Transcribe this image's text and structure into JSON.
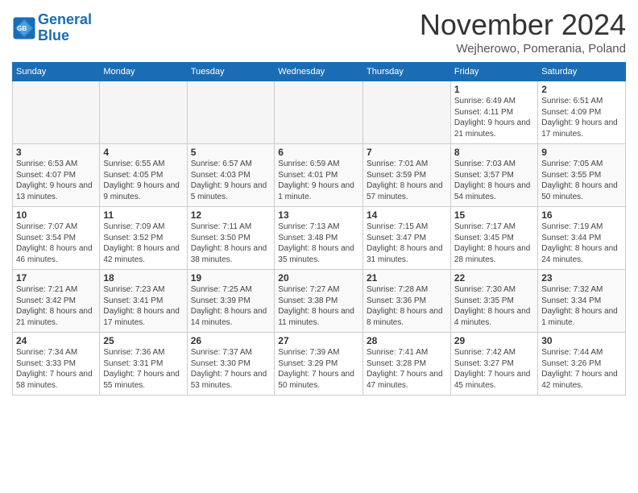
{
  "header": {
    "logo_line1": "General",
    "logo_line2": "Blue",
    "month_title": "November 2024",
    "location": "Wejherowo, Pomerania, Poland"
  },
  "weekdays": [
    "Sunday",
    "Monday",
    "Tuesday",
    "Wednesday",
    "Thursday",
    "Friday",
    "Saturday"
  ],
  "weeks": [
    [
      {
        "day": "",
        "info": ""
      },
      {
        "day": "",
        "info": ""
      },
      {
        "day": "",
        "info": ""
      },
      {
        "day": "",
        "info": ""
      },
      {
        "day": "",
        "info": ""
      },
      {
        "day": "1",
        "info": "Sunrise: 6:49 AM\nSunset: 4:11 PM\nDaylight: 9 hours and 21 minutes."
      },
      {
        "day": "2",
        "info": "Sunrise: 6:51 AM\nSunset: 4:09 PM\nDaylight: 9 hours and 17 minutes."
      }
    ],
    [
      {
        "day": "3",
        "info": "Sunrise: 6:53 AM\nSunset: 4:07 PM\nDaylight: 9 hours and 13 minutes."
      },
      {
        "day": "4",
        "info": "Sunrise: 6:55 AM\nSunset: 4:05 PM\nDaylight: 9 hours and 9 minutes."
      },
      {
        "day": "5",
        "info": "Sunrise: 6:57 AM\nSunset: 4:03 PM\nDaylight: 9 hours and 5 minutes."
      },
      {
        "day": "6",
        "info": "Sunrise: 6:59 AM\nSunset: 4:01 PM\nDaylight: 9 hours and 1 minute."
      },
      {
        "day": "7",
        "info": "Sunrise: 7:01 AM\nSunset: 3:59 PM\nDaylight: 8 hours and 57 minutes."
      },
      {
        "day": "8",
        "info": "Sunrise: 7:03 AM\nSunset: 3:57 PM\nDaylight: 8 hours and 54 minutes."
      },
      {
        "day": "9",
        "info": "Sunrise: 7:05 AM\nSunset: 3:55 PM\nDaylight: 8 hours and 50 minutes."
      }
    ],
    [
      {
        "day": "10",
        "info": "Sunrise: 7:07 AM\nSunset: 3:54 PM\nDaylight: 8 hours and 46 minutes."
      },
      {
        "day": "11",
        "info": "Sunrise: 7:09 AM\nSunset: 3:52 PM\nDaylight: 8 hours and 42 minutes."
      },
      {
        "day": "12",
        "info": "Sunrise: 7:11 AM\nSunset: 3:50 PM\nDaylight: 8 hours and 38 minutes."
      },
      {
        "day": "13",
        "info": "Sunrise: 7:13 AM\nSunset: 3:48 PM\nDaylight: 8 hours and 35 minutes."
      },
      {
        "day": "14",
        "info": "Sunrise: 7:15 AM\nSunset: 3:47 PM\nDaylight: 8 hours and 31 minutes."
      },
      {
        "day": "15",
        "info": "Sunrise: 7:17 AM\nSunset: 3:45 PM\nDaylight: 8 hours and 28 minutes."
      },
      {
        "day": "16",
        "info": "Sunrise: 7:19 AM\nSunset: 3:44 PM\nDaylight: 8 hours and 24 minutes."
      }
    ],
    [
      {
        "day": "17",
        "info": "Sunrise: 7:21 AM\nSunset: 3:42 PM\nDaylight: 8 hours and 21 minutes."
      },
      {
        "day": "18",
        "info": "Sunrise: 7:23 AM\nSunset: 3:41 PM\nDaylight: 8 hours and 17 minutes."
      },
      {
        "day": "19",
        "info": "Sunrise: 7:25 AM\nSunset: 3:39 PM\nDaylight: 8 hours and 14 minutes."
      },
      {
        "day": "20",
        "info": "Sunrise: 7:27 AM\nSunset: 3:38 PM\nDaylight: 8 hours and 11 minutes."
      },
      {
        "day": "21",
        "info": "Sunrise: 7:28 AM\nSunset: 3:36 PM\nDaylight: 8 hours and 8 minutes."
      },
      {
        "day": "22",
        "info": "Sunrise: 7:30 AM\nSunset: 3:35 PM\nDaylight: 8 hours and 4 minutes."
      },
      {
        "day": "23",
        "info": "Sunrise: 7:32 AM\nSunset: 3:34 PM\nDaylight: 8 hours and 1 minute."
      }
    ],
    [
      {
        "day": "24",
        "info": "Sunrise: 7:34 AM\nSunset: 3:33 PM\nDaylight: 7 hours and 58 minutes."
      },
      {
        "day": "25",
        "info": "Sunrise: 7:36 AM\nSunset: 3:31 PM\nDaylight: 7 hours and 55 minutes."
      },
      {
        "day": "26",
        "info": "Sunrise: 7:37 AM\nSunset: 3:30 PM\nDaylight: 7 hours and 53 minutes."
      },
      {
        "day": "27",
        "info": "Sunrise: 7:39 AM\nSunset: 3:29 PM\nDaylight: 7 hours and 50 minutes."
      },
      {
        "day": "28",
        "info": "Sunrise: 7:41 AM\nSunset: 3:28 PM\nDaylight: 7 hours and 47 minutes."
      },
      {
        "day": "29",
        "info": "Sunrise: 7:42 AM\nSunset: 3:27 PM\nDaylight: 7 hours and 45 minutes."
      },
      {
        "day": "30",
        "info": "Sunrise: 7:44 AM\nSunset: 3:26 PM\nDaylight: 7 hours and 42 minutes."
      }
    ]
  ]
}
